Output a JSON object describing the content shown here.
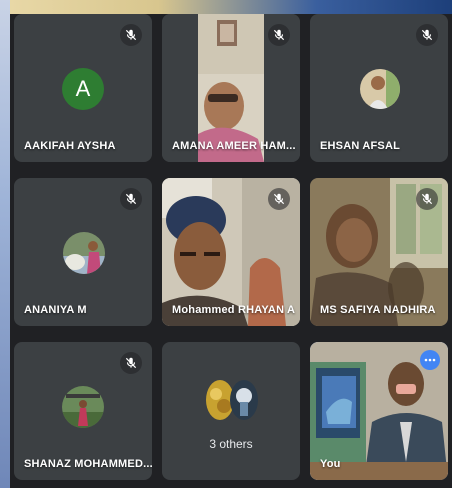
{
  "participants": [
    {
      "name": "AAKIFAH AYSHA",
      "avatar_letter": "A",
      "muted": true
    },
    {
      "name": "AMANA AMEER HAM...",
      "muted": true
    },
    {
      "name": "EHSAN AFSAL",
      "muted": true
    },
    {
      "name": "ANANIYA M",
      "muted": true
    },
    {
      "name": "Mohammed RHAYAN A",
      "muted": true
    },
    {
      "name": "MS SAFIYA NADHIRA",
      "muted": true
    },
    {
      "name": "SHANAZ MOHAMMED...",
      "muted": true
    },
    {
      "name": "You",
      "muted": false
    }
  ],
  "others": {
    "label": "3 others"
  },
  "colors": {
    "tile_bg": "#3c4043",
    "active_border": "#8ab4f8",
    "avatar_green": "#2e7d32",
    "more_button": "#4285f4"
  },
  "icons": {
    "mic_off": "mic-off-icon",
    "more": "more-options-icon"
  }
}
